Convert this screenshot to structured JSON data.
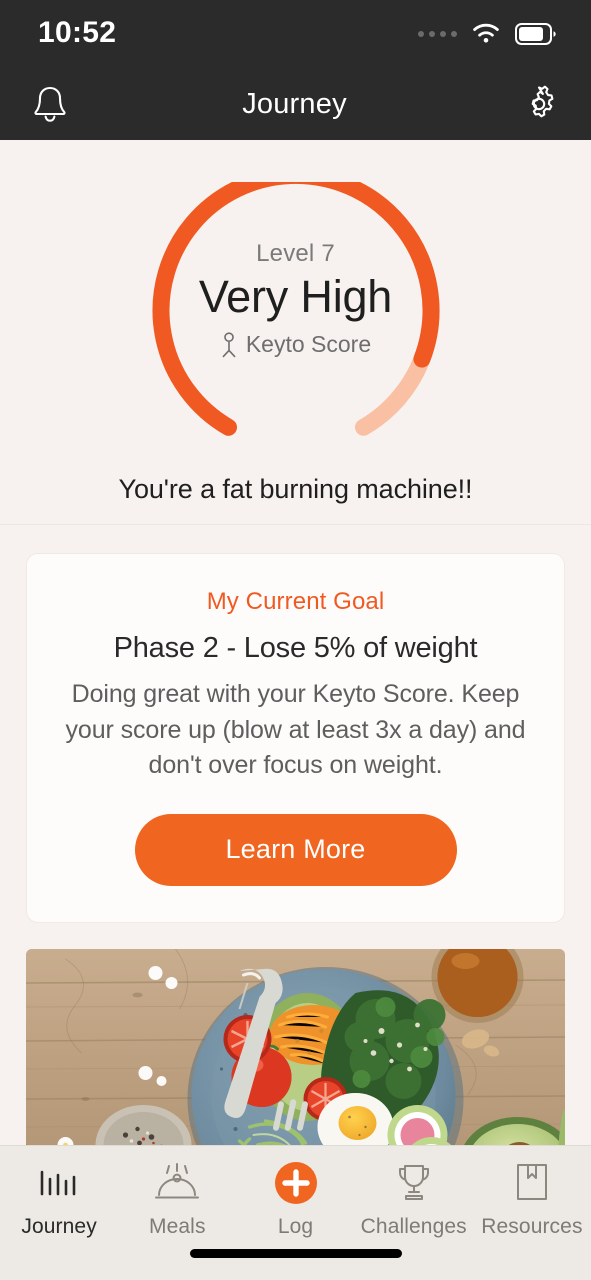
{
  "statusbar": {
    "time": "10:52",
    "signal_icon": "signal-dots-icon",
    "wifi_icon": "wifi-icon",
    "battery_icon": "battery-icon",
    "battery_level_percent": 75
  },
  "navbar": {
    "title": "Journey",
    "left_icon": "bell-icon",
    "right_icon": "gear-icon"
  },
  "hero": {
    "gauge": {
      "level_label": "Level 7",
      "value_label": "Very High",
      "score_label": "Keyto Score",
      "score_icon": "person-icon",
      "progress_percent": 87,
      "fill_color": "#F05A22",
      "track_color": "#FAC0A3"
    },
    "message": "You're a fat burning machine!!"
  },
  "goal_card": {
    "kicker": "My Current Goal",
    "kicker_color": "#F05A22",
    "title": "Phase 2 - Lose 5% of weight",
    "body": "Doing great with your Keyto Score. Keep your score up (blow at least 3x a day) and don't over focus on weight.",
    "button_label": "Learn More",
    "button_color": "#F0651F"
  },
  "photo_card": {
    "alt": "Blue ceramic bowl with kale salad, boiled eggs, tomatoes, radish and avocado on a rustic wooden table"
  },
  "tabbar": {
    "active_index": 0,
    "accent_color": "#F0651F",
    "items": [
      {
        "label": "Journey",
        "icon": "bar-chart-icon"
      },
      {
        "label": "Meals",
        "icon": "cloche-icon"
      },
      {
        "label": "Log",
        "icon": "plus-circle-icon"
      },
      {
        "label": "Challenges",
        "icon": "trophy-icon"
      },
      {
        "label": "Resources",
        "icon": "bookmark-book-icon"
      }
    ]
  }
}
